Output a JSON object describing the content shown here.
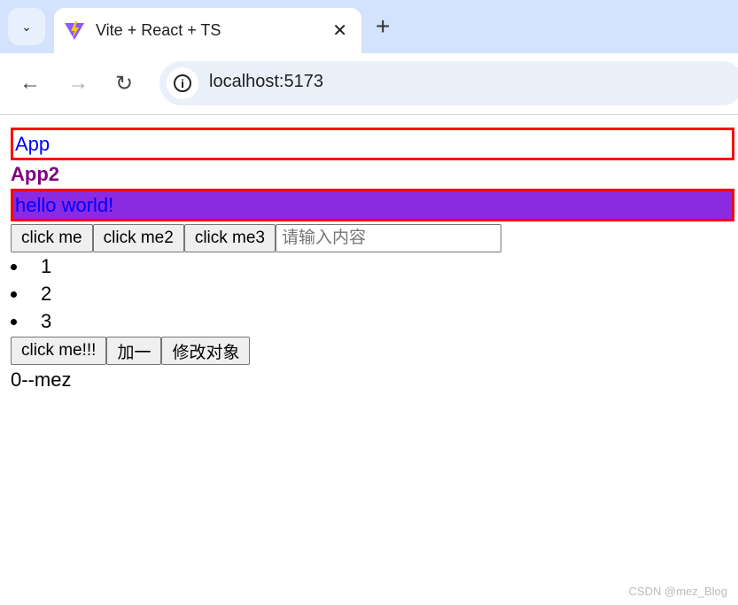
{
  "browser": {
    "tab_title": "Vite + React + TS",
    "url": "localhost:5173"
  },
  "page": {
    "app_title": "App",
    "app2_title": "App2",
    "hello": "hello world!",
    "buttons_row1": [
      "click me",
      "click me2",
      "click me3"
    ],
    "input_placeholder": "请输入内容",
    "input_value": "",
    "list": [
      "1",
      "2",
      "3"
    ],
    "buttons_row2": [
      "click me!!!",
      "加一",
      "修改对象"
    ],
    "output": "0--mez"
  },
  "watermark": "CSDN @mez_Blog",
  "colors": {
    "border": "#ff0000",
    "hello_bg": "#8a2be2",
    "app2": "#800080",
    "text_blue": "#0000ff"
  }
}
